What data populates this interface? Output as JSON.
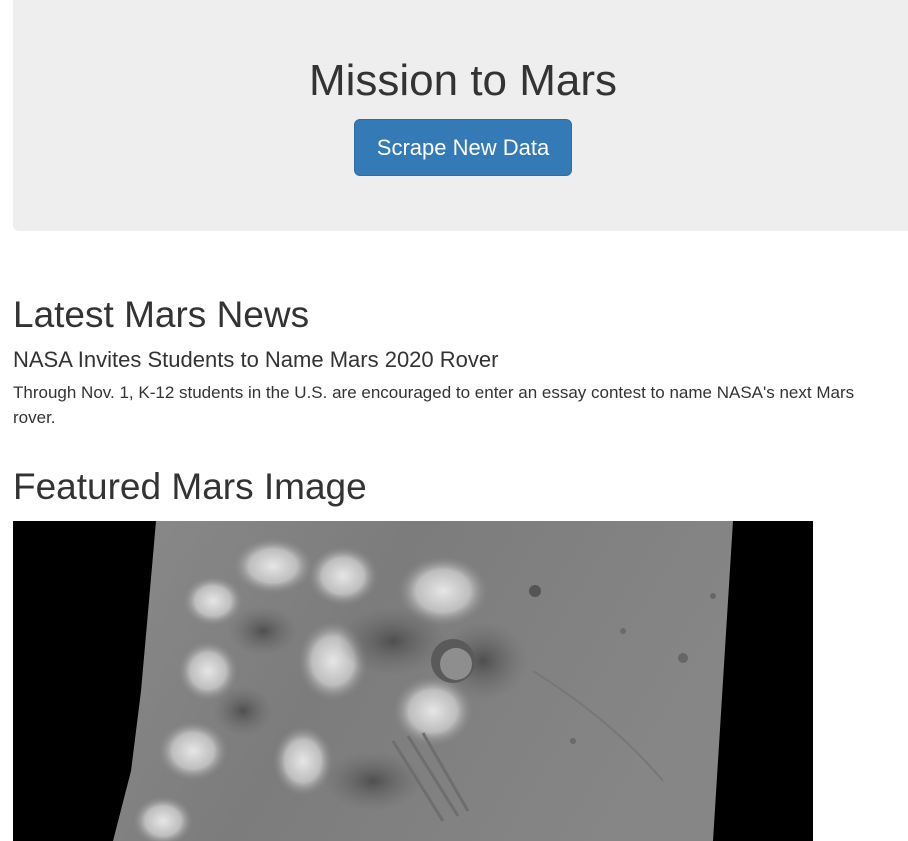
{
  "header": {
    "title": "Mission to Mars",
    "scrape_button": "Scrape New Data"
  },
  "news": {
    "heading": "Latest Mars News",
    "title": "NASA Invites Students to Name Mars 2020 Rover",
    "paragraph": "Through Nov. 1, K-12 students in the U.S. are encouraged to enter an essay contest to name NASA's next Mars rover."
  },
  "featured_image": {
    "heading": "Featured Mars Image"
  },
  "colors": {
    "jumbotron_bg": "#eeeeee",
    "button_bg": "#337ab7",
    "text": "#333333"
  }
}
